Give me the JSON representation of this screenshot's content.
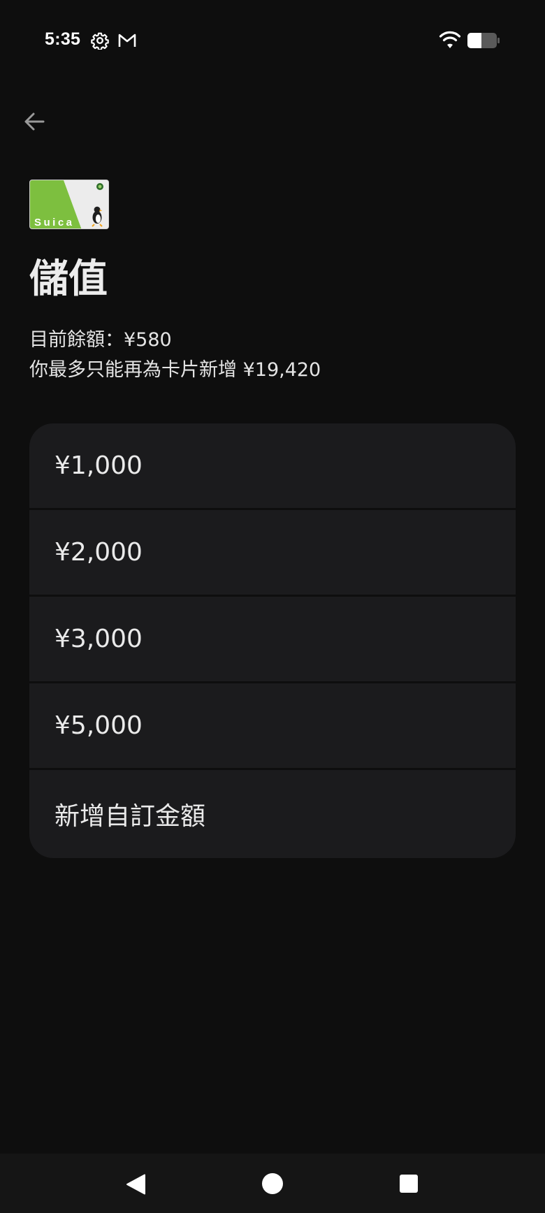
{
  "status_bar": {
    "time": "5:35",
    "icons": [
      "gear-icon",
      "gmail-icon",
      "wifi-icon",
      "battery-icon"
    ]
  },
  "header": {
    "back_icon": "arrow-left-icon"
  },
  "card": {
    "logo_text": "Suica",
    "accent_color": "#7dbf3f"
  },
  "page": {
    "title": "儲值",
    "current_balance": "目前餘額：¥580",
    "max_add": "你最多只能再為卡片新增 ¥19,420"
  },
  "options": [
    {
      "label": "¥1,000"
    },
    {
      "label": "¥2,000"
    },
    {
      "label": "¥3,000"
    },
    {
      "label": "¥5,000"
    },
    {
      "label": "新增自訂金額"
    }
  ],
  "nav_bar": {
    "icons": [
      "nav-back-icon",
      "nav-home-icon",
      "nav-recents-icon"
    ]
  },
  "colors": {
    "background": "#0e0e0e",
    "option_bg": "#1b1b1d",
    "text": "#eaeaea"
  }
}
